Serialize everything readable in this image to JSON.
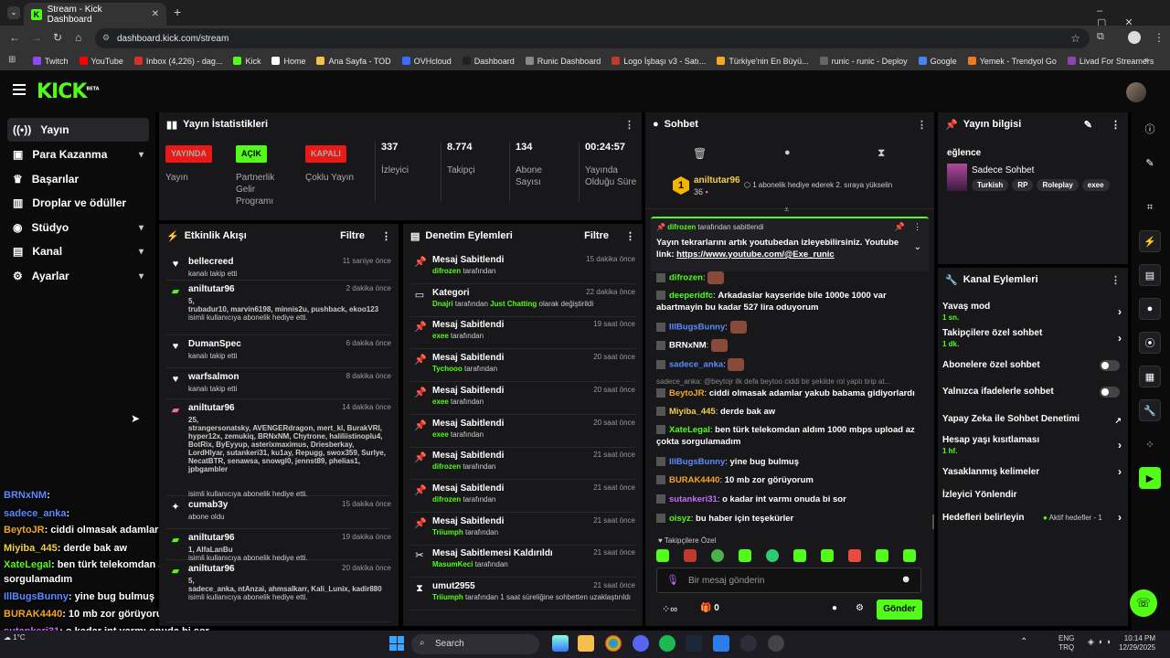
{
  "browser": {
    "tab_title": "Stream - Kick Dashboard",
    "url": "dashboard.kick.com/stream",
    "bookmarks": [
      "Twitch",
      "YouTube",
      "Inbox (4,226) - dag...",
      "Kick",
      "Home",
      "Ana Sayfa - TOD",
      "OVHcloud",
      "Dashboard",
      "Runic Dashboard",
      "Logo İşbaşı v3 - Satı...",
      "Türkiye'nin En Büyü...",
      "runic - runic - Deploy",
      "Google",
      "Yemek - Trendyol Go",
      "Livad For Streamers"
    ],
    "all_bookmarks": "»"
  },
  "header": {
    "logo": "KICK",
    "logo_beta": "BETA"
  },
  "sidebar": {
    "items": [
      {
        "label": "Yayın"
      },
      {
        "label": "Para Kazanma"
      },
      {
        "label": "Başarılar"
      },
      {
        "label": "Droplar ve ödüller"
      },
      {
        "label": "Stüdyo"
      },
      {
        "label": "Kanal"
      },
      {
        "label": "Ayarlar"
      }
    ]
  },
  "stats": {
    "title": "Yayın İstatistikleri",
    "live_badge": "YAYINDA",
    "live_label": "Yayın",
    "partner_badge": "AÇIK",
    "partner_label": "Partnerlik Gelir Programı",
    "multi_badge": "KAPALI",
    "multi_label": "Çoklu Yayın",
    "viewers": "337",
    "viewers_label": "İzleyici",
    "followers": "8.774",
    "followers_label": "Takipçi",
    "subs": "134",
    "subs_label": "Abone Sayısı",
    "duration": "00:24:57",
    "duration_label": "Yayında Olduğu Süre"
  },
  "activity": {
    "title": "Etkinlik Akışı",
    "filter": "Filtre",
    "items": [
      {
        "name": "bellecreed",
        "time": "11 saniye önce",
        "sub": "kanalı takip etti"
      },
      {
        "name": "aniltutar96",
        "time": "2 dakika önce",
        "count": "5,",
        "users": "trubadur10, marvin6198, minnis2u, pushback, ekoo123",
        "sub": "isimli kullanıcıya abonelik hediye etti."
      },
      {
        "name": "DumanSpec",
        "time": "6 dakika önce",
        "sub": "kanalı takip etti"
      },
      {
        "name": "warfsalmon",
        "time": "8 dakika önce",
        "sub": "kanalı takip etti"
      },
      {
        "name": "aniltutar96",
        "time": "14 dakika önce",
        "count": "25,",
        "users": "strangersonatsky, AVENGERdragon, mert_kl, BurakVRI, hyper12x, zemukiq, BRNxNM, Chytrone, haliliistinoplu4, BotRix, ByEyyup, asterixmaximus, Driesberkay, LordHlyar, sutankeri31, ku1ay, Repugg, swox359, Surlye, NecatBTR, senawsa, snowgl0, jennst89, phelias1, jpbgambler",
        "sub": "isimli kullanıcıya abonelik hediye etti."
      },
      {
        "name": "cumab3y",
        "time": "15 dakika önce",
        "sub": "abone oldu"
      },
      {
        "name": "aniltutar96",
        "time": "19 dakika önce",
        "count": "1, AlfaLanBu",
        "sub": "isimli kullanıcıya abonelik hediye etti."
      },
      {
        "name": "aniltutar96",
        "time": "20 dakika önce",
        "count": "5,",
        "users": "sadece_anka, ntAnzai, ahmsalkarr, Kali_Lunix, kadir880",
        "sub": "isimli kullanıcıya abonelik hediye etti."
      }
    ]
  },
  "moderation": {
    "title": "Denetim Eylemleri",
    "filter": "Filtre",
    "items": [
      {
        "action": "Mesaj Sabitlendi",
        "time": "15 dakika önce",
        "who": "difrozen",
        "rest": "tarafından"
      },
      {
        "action": "Kategori",
        "time": "22 dakika önce",
        "who": "Dnajri",
        "rest": "tarafından",
        "extra": "Just Chatting",
        "rest2": "olarak değiştirildi"
      },
      {
        "action": "Mesaj Sabitlendi",
        "time": "19 saat önce",
        "who": "exee",
        "rest": "tarafından"
      },
      {
        "action": "Mesaj Sabitlendi",
        "time": "20 saat önce",
        "who": "Tychooo",
        "rest": "tarafından"
      },
      {
        "action": "Mesaj Sabitlendi",
        "time": "20 saat önce",
        "who": "exee",
        "rest": "tarafından"
      },
      {
        "action": "Mesaj Sabitlendi",
        "time": "20 saat önce",
        "who": "exee",
        "rest": "tarafından"
      },
      {
        "action": "Mesaj Sabitlendi",
        "time": "21 saat önce",
        "who": "difrozen",
        "rest": "tarafından"
      },
      {
        "action": "Mesaj Sabitlendi",
        "time": "21 saat önce",
        "who": "difrozen",
        "rest": "tarafından"
      },
      {
        "action": "Mesaj Sabitlendi",
        "time": "21 saat önce",
        "who": "Triiumph",
        "rest": "tarafından"
      },
      {
        "action": "Mesaj Sabitlemesi Kaldırıldı",
        "time": "21 saat önce",
        "who": "MasumKeci",
        "rest": "tarafından"
      },
      {
        "action": "umut2955",
        "time": "21 saat önce",
        "who": "Triiumph",
        "rest": "tarafından 1 saat süreliğine sohbetten uzaklaştırıldı"
      }
    ]
  },
  "chat": {
    "title": "Sohbet",
    "leader_name": "aniltutar96",
    "leader_count": "36",
    "leader_rank": "1",
    "leader_text": "1 abonelik hediye ederek 2. sıraya yükselin",
    "pinned_by": "difrozen",
    "pinned_by_rest": "tarafından sabitlendi",
    "pinned_text": "Yayın tekrarlarını artık youtubedan izleyebilirsiniz. Youtube link:",
    "pinned_link": "https://www.youtube.com/@Exe_runic",
    "messages": [
      {
        "user": "difrozen",
        "color": "#53fc18",
        "text": ""
      },
      {
        "user": "deeperidfc",
        "color": "#53fc18",
        "text": "Arkadaslar kayseride bile 1000e 1000 var abartmayin bu kadar 527 lira oduyorum"
      },
      {
        "user": "IllBugsBunny",
        "color": "#5b8cff",
        "text": ""
      },
      {
        "user": "BRNxNM",
        "color": "#ffffff",
        "text": ""
      },
      {
        "user": "sadece_anka",
        "color": "#5b8cff",
        "text": ""
      },
      {
        "reply": "sadece_anka: @beytojr ilk defa beytoo ciddi bir şekilde rol yaptı tirip at..."
      },
      {
        "user": "BeytoJR",
        "color": "#f5a623",
        "text": "ciddi olmasak adamlar yakub babama gidiyorlardı"
      },
      {
        "user": "Miyiba_445",
        "color": "#f5d04a",
        "text": "derde bak aw"
      },
      {
        "user": "XateLegal",
        "color": "#53fc18",
        "text": "ben türk telekomdan aldım 1000 mbps upload az çokta sorgulamadım"
      },
      {
        "user": "IllBugsBunny",
        "color": "#5b8cff",
        "text": "yine bug bulmuş"
      },
      {
        "user": "BURAK4440",
        "color": "#f5a623",
        "text": "10 mb zor görüyorum"
      },
      {
        "user": "sutankeri31",
        "color": "#c86bff",
        "text": "o kadar int varmı onuda bi sor"
      },
      {
        "user": "oisyz",
        "color": "#53fc18",
        "text": "bu haber için teşekürler"
      }
    ],
    "followers_only": "Takipçilere Özel",
    "input_placeholder": "Bir mesaj gönderin",
    "gift_count": "0",
    "send_label": "Gönder"
  },
  "info": {
    "title": "Yayın bilgisi",
    "stream_title": "eğlence",
    "category": "Sadece Sohbet",
    "tags": [
      "Turkish",
      "RP",
      "Roleplay",
      "exee"
    ]
  },
  "channel_actions": {
    "title": "Kanal Eylemleri",
    "slow_mode": "Yavaş mod",
    "slow_val": "1 sn.",
    "follower_chat": "Takipçilere özel sohbet",
    "follower_val": "1 dk.",
    "sub_chat": "Abonelere özel sohbet",
    "emote_chat": "Yalnızca ifadelerle sohbet",
    "ai_mod": "Yapay Zeka ile Sohbet Denetimi",
    "account_age": "Hesap yaşı kısıtlaması",
    "account_val": "1 hf.",
    "banned_words": "Yasaklanmış kelimeler",
    "raid": "İzleyici Yönlendir",
    "goals": "Hedefleri belirleyin",
    "goals_val": "Aktif hedefler - 1"
  },
  "overlay_chat": [
    {
      "user": "BRNxNM",
      "color": "#5b8cff",
      "text": ":"
    },
    {
      "user": "sadece_anka",
      "color": "#5b8cff",
      "text": ":"
    },
    {
      "user": "BeytoJR",
      "color": "#f5a623",
      "text": ": ciddi olmasak adamlar yakub babama gidiyorlardı"
    },
    {
      "user": "Miyiba_445",
      "color": "#f5d04a",
      "text": ": derde bak aw"
    },
    {
      "user": "XateLegal",
      "color": "#53fc18",
      "text": ": ben türk telekomdan aldım 1000 mbps upload az çokta"
    },
    {
      "user": "",
      "color": "#ffffff",
      "text": "sorgulamadım"
    },
    {
      "user": "IllBugsBunny",
      "color": "#5b8cff",
      "text": ": yine bug bulmuş"
    },
    {
      "user": "BURAK4440",
      "color": "#f5a623",
      "text": ": 10 mb zor görüyorum"
    },
    {
      "user": "sutankeri31",
      "color": "#c86bff",
      "text": ": o kadar int varmı onuda bi sor"
    },
    {
      "user": "",
      "color": "#ffffff",
      "text": "için teşekürler"
    }
  ],
  "taskbar": {
    "search": "Search",
    "lang": "ENG",
    "lang2": "TRQ",
    "time": "10:14 PM",
    "date": "12/29/2025",
    "weather": "1°C"
  },
  "colors": {
    "accent": "#53fc18",
    "panel": "#18181b",
    "red": "#e91916"
  }
}
